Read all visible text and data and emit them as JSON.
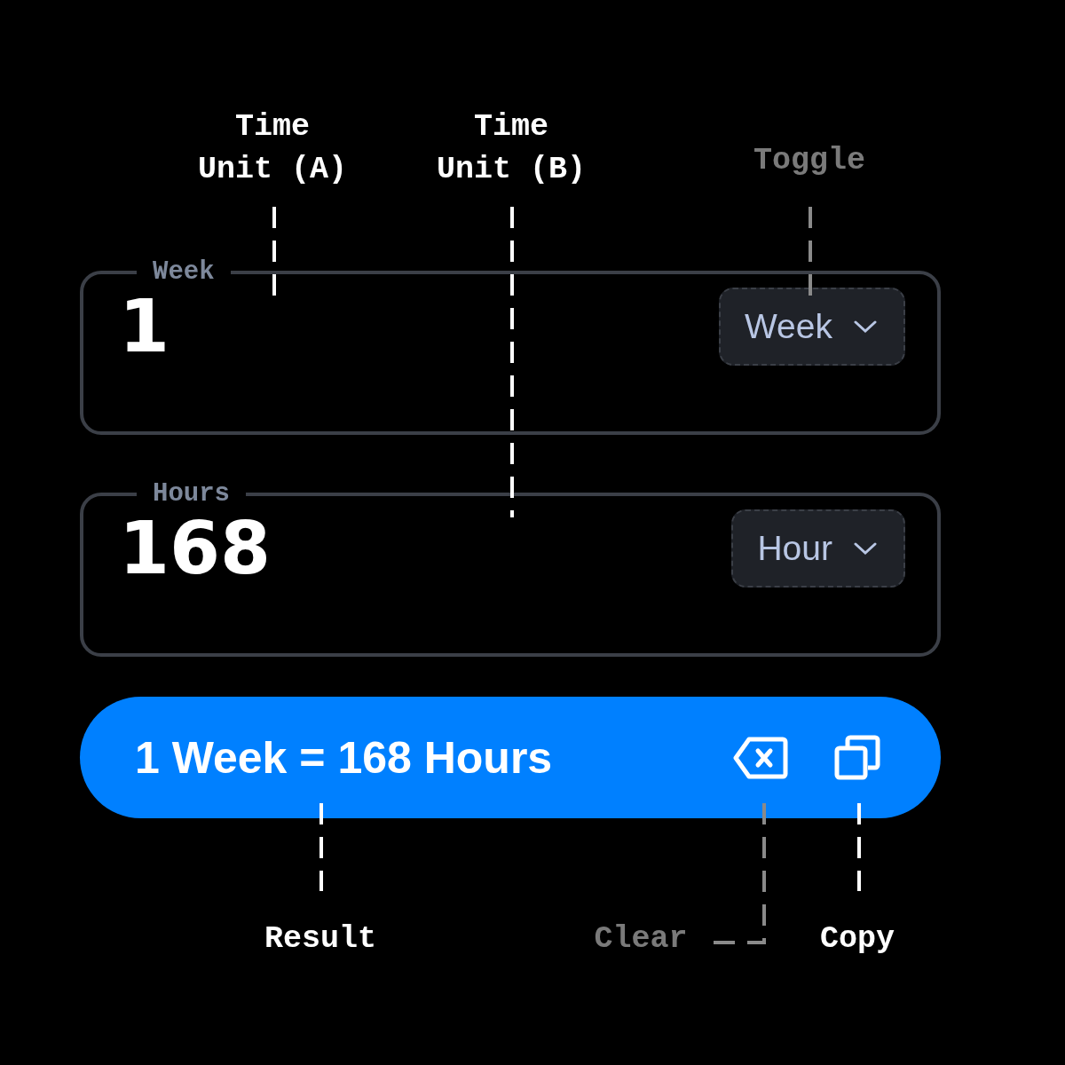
{
  "fields": [
    {
      "label": "Week",
      "value": "1",
      "unit": "Week"
    },
    {
      "label": "Hours",
      "value": "168",
      "unit": "Hour"
    }
  ],
  "result": {
    "text": "1 Week = 168 Hours",
    "actions": [
      {
        "kind": "clear"
      },
      {
        "kind": "copy"
      }
    ]
  },
  "callouts": [
    {
      "label": "Time Unit (A)",
      "dimmed": false
    },
    {
      "label": "Time Unit (B)",
      "dimmed": false
    },
    {
      "label": "Toggle",
      "dimmed": true
    },
    {
      "label": "Result",
      "dimmed": false
    },
    {
      "label": "Clear",
      "dimmed": true
    },
    {
      "label": "Copy",
      "dimmed": false
    }
  ]
}
